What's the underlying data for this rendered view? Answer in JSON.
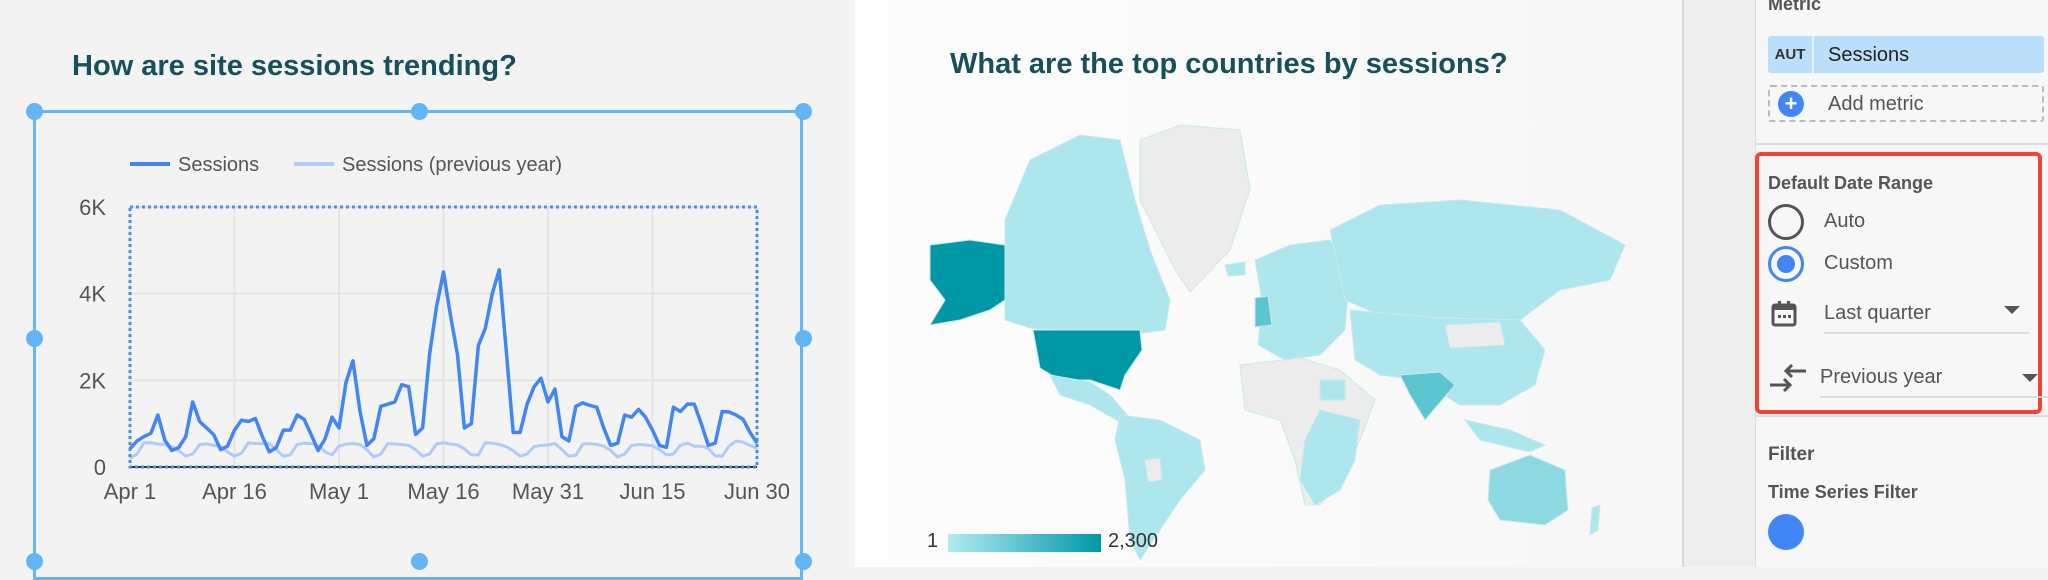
{
  "left_chart": {
    "title": "How are site sessions trending?",
    "chart_data": {
      "type": "line",
      "x_start": "Apr 1",
      "x_end": "Jun 30",
      "xticks": [
        "Apr 1",
        "Apr 16",
        "May 1",
        "May 16",
        "May 31",
        "Jun 15",
        "Jun 30"
      ],
      "xtick_days": [
        0,
        15,
        30,
        45,
        60,
        75,
        90
      ],
      "yticks": [
        "0",
        "2K",
        "4K",
        "6K"
      ],
      "ytick_values": [
        0,
        2000,
        4000,
        6000
      ],
      "ylim": [
        0,
        6000
      ],
      "grid": true,
      "legend": "top",
      "series": [
        {
          "name": "Sessions",
          "color": "#4285f4",
          "values": [
            420,
            600,
            700,
            780,
            1200,
            620,
            380,
            450,
            700,
            1500,
            1050,
            900,
            750,
            400,
            480,
            850,
            1080,
            1050,
            1120,
            700,
            350,
            450,
            850,
            850,
            1200,
            1100,
            750,
            380,
            650,
            1150,
            900,
            1950,
            2450,
            1300,
            500,
            650,
            1400,
            1450,
            1500,
            1900,
            1850,
            750,
            900,
            2600,
            3700,
            4500,
            3500,
            2600,
            900,
            1000,
            2800,
            3200,
            4000,
            4550,
            2700,
            800,
            800,
            1450,
            1850,
            2050,
            1500,
            1800,
            700,
            600,
            1400,
            1480,
            1420,
            1380,
            900,
            500,
            550,
            1200,
            1150,
            1330,
            1150,
            850,
            500,
            450,
            1380,
            1280,
            1450,
            1450,
            1000,
            500,
            550,
            1280,
            1270,
            1200,
            1100,
            800,
            550
          ]
        },
        {
          "name": "Sessions (previous year)",
          "color": "#aecbfa",
          "values": [
            200,
            300,
            560,
            560,
            530,
            520,
            470,
            380,
            250,
            300,
            520,
            530,
            500,
            470,
            350,
            250,
            320,
            560,
            540,
            540,
            540,
            400,
            250,
            280,
            520,
            550,
            540,
            500,
            350,
            280,
            480,
            530,
            540,
            520,
            400,
            230,
            300,
            540,
            530,
            520,
            500,
            400,
            250,
            300,
            530,
            560,
            530,
            510,
            420,
            280,
            280,
            560,
            550,
            520,
            470,
            380,
            250,
            300,
            470,
            500,
            510,
            540,
            400,
            250,
            270,
            530,
            540,
            520,
            480,
            380,
            230,
            300,
            500,
            520,
            510,
            490,
            400,
            280,
            300,
            500,
            550,
            480,
            480,
            430,
            260,
            250,
            480,
            600,
            570,
            500,
            430
          ]
        }
      ]
    }
  },
  "map_chart": {
    "title": "What are the top countries by sessions?",
    "legend_min": "1",
    "legend_max": "2,300",
    "color_low": "#b2ebf2",
    "color_high": "#0097a7"
  },
  "panel": {
    "metric_heading": "Metric",
    "metric_chip_type": "AUT",
    "metric_chip_name": "Sessions",
    "add_metric": "Add metric",
    "date_range_heading": "Default Date Range",
    "radio_auto": "Auto",
    "radio_custom": "Custom",
    "selected_radio": "Custom",
    "date_range_value": "Last quarter",
    "comparison_value": "Previous year",
    "filter_heading": "Filter",
    "time_series_filter": "Time Series Filter",
    "highlight_color": "#f44336"
  }
}
